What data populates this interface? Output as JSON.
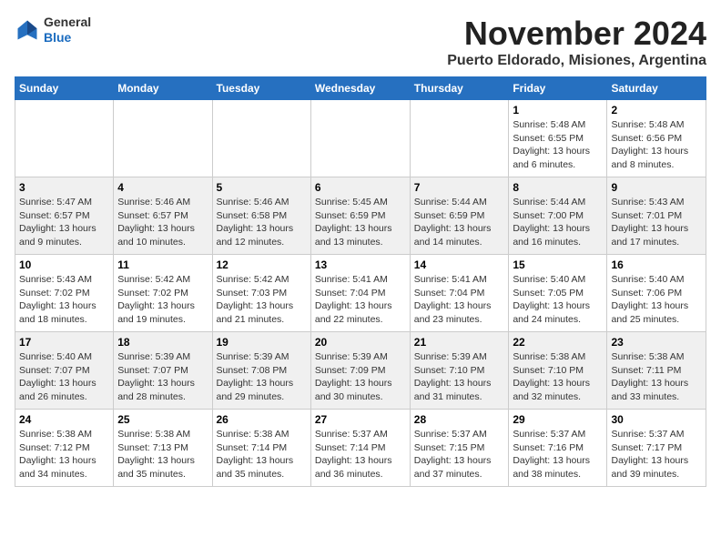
{
  "logo": {
    "general": "General",
    "blue": "Blue"
  },
  "header": {
    "month": "November 2024",
    "location": "Puerto Eldorado, Misiones, Argentina"
  },
  "days_of_week": [
    "Sunday",
    "Monday",
    "Tuesday",
    "Wednesday",
    "Thursday",
    "Friday",
    "Saturday"
  ],
  "weeks": [
    [
      {
        "day": "",
        "info": ""
      },
      {
        "day": "",
        "info": ""
      },
      {
        "day": "",
        "info": ""
      },
      {
        "day": "",
        "info": ""
      },
      {
        "day": "",
        "info": ""
      },
      {
        "day": "1",
        "info": "Sunrise: 5:48 AM\nSunset: 6:55 PM\nDaylight: 13 hours and 6 minutes."
      },
      {
        "day": "2",
        "info": "Sunrise: 5:48 AM\nSunset: 6:56 PM\nDaylight: 13 hours and 8 minutes."
      }
    ],
    [
      {
        "day": "3",
        "info": "Sunrise: 5:47 AM\nSunset: 6:57 PM\nDaylight: 13 hours and 9 minutes."
      },
      {
        "day": "4",
        "info": "Sunrise: 5:46 AM\nSunset: 6:57 PM\nDaylight: 13 hours and 10 minutes."
      },
      {
        "day": "5",
        "info": "Sunrise: 5:46 AM\nSunset: 6:58 PM\nDaylight: 13 hours and 12 minutes."
      },
      {
        "day": "6",
        "info": "Sunrise: 5:45 AM\nSunset: 6:59 PM\nDaylight: 13 hours and 13 minutes."
      },
      {
        "day": "7",
        "info": "Sunrise: 5:44 AM\nSunset: 6:59 PM\nDaylight: 13 hours and 14 minutes."
      },
      {
        "day": "8",
        "info": "Sunrise: 5:44 AM\nSunset: 7:00 PM\nDaylight: 13 hours and 16 minutes."
      },
      {
        "day": "9",
        "info": "Sunrise: 5:43 AM\nSunset: 7:01 PM\nDaylight: 13 hours and 17 minutes."
      }
    ],
    [
      {
        "day": "10",
        "info": "Sunrise: 5:43 AM\nSunset: 7:02 PM\nDaylight: 13 hours and 18 minutes."
      },
      {
        "day": "11",
        "info": "Sunrise: 5:42 AM\nSunset: 7:02 PM\nDaylight: 13 hours and 19 minutes."
      },
      {
        "day": "12",
        "info": "Sunrise: 5:42 AM\nSunset: 7:03 PM\nDaylight: 13 hours and 21 minutes."
      },
      {
        "day": "13",
        "info": "Sunrise: 5:41 AM\nSunset: 7:04 PM\nDaylight: 13 hours and 22 minutes."
      },
      {
        "day": "14",
        "info": "Sunrise: 5:41 AM\nSunset: 7:04 PM\nDaylight: 13 hours and 23 minutes."
      },
      {
        "day": "15",
        "info": "Sunrise: 5:40 AM\nSunset: 7:05 PM\nDaylight: 13 hours and 24 minutes."
      },
      {
        "day": "16",
        "info": "Sunrise: 5:40 AM\nSunset: 7:06 PM\nDaylight: 13 hours and 25 minutes."
      }
    ],
    [
      {
        "day": "17",
        "info": "Sunrise: 5:40 AM\nSunset: 7:07 PM\nDaylight: 13 hours and 26 minutes."
      },
      {
        "day": "18",
        "info": "Sunrise: 5:39 AM\nSunset: 7:07 PM\nDaylight: 13 hours and 28 minutes."
      },
      {
        "day": "19",
        "info": "Sunrise: 5:39 AM\nSunset: 7:08 PM\nDaylight: 13 hours and 29 minutes."
      },
      {
        "day": "20",
        "info": "Sunrise: 5:39 AM\nSunset: 7:09 PM\nDaylight: 13 hours and 30 minutes."
      },
      {
        "day": "21",
        "info": "Sunrise: 5:39 AM\nSunset: 7:10 PM\nDaylight: 13 hours and 31 minutes."
      },
      {
        "day": "22",
        "info": "Sunrise: 5:38 AM\nSunset: 7:10 PM\nDaylight: 13 hours and 32 minutes."
      },
      {
        "day": "23",
        "info": "Sunrise: 5:38 AM\nSunset: 7:11 PM\nDaylight: 13 hours and 33 minutes."
      }
    ],
    [
      {
        "day": "24",
        "info": "Sunrise: 5:38 AM\nSunset: 7:12 PM\nDaylight: 13 hours and 34 minutes."
      },
      {
        "day": "25",
        "info": "Sunrise: 5:38 AM\nSunset: 7:13 PM\nDaylight: 13 hours and 35 minutes."
      },
      {
        "day": "26",
        "info": "Sunrise: 5:38 AM\nSunset: 7:14 PM\nDaylight: 13 hours and 35 minutes."
      },
      {
        "day": "27",
        "info": "Sunrise: 5:37 AM\nSunset: 7:14 PM\nDaylight: 13 hours and 36 minutes."
      },
      {
        "day": "28",
        "info": "Sunrise: 5:37 AM\nSunset: 7:15 PM\nDaylight: 13 hours and 37 minutes."
      },
      {
        "day": "29",
        "info": "Sunrise: 5:37 AM\nSunset: 7:16 PM\nDaylight: 13 hours and 38 minutes."
      },
      {
        "day": "30",
        "info": "Sunrise: 5:37 AM\nSunset: 7:17 PM\nDaylight: 13 hours and 39 minutes."
      }
    ]
  ]
}
